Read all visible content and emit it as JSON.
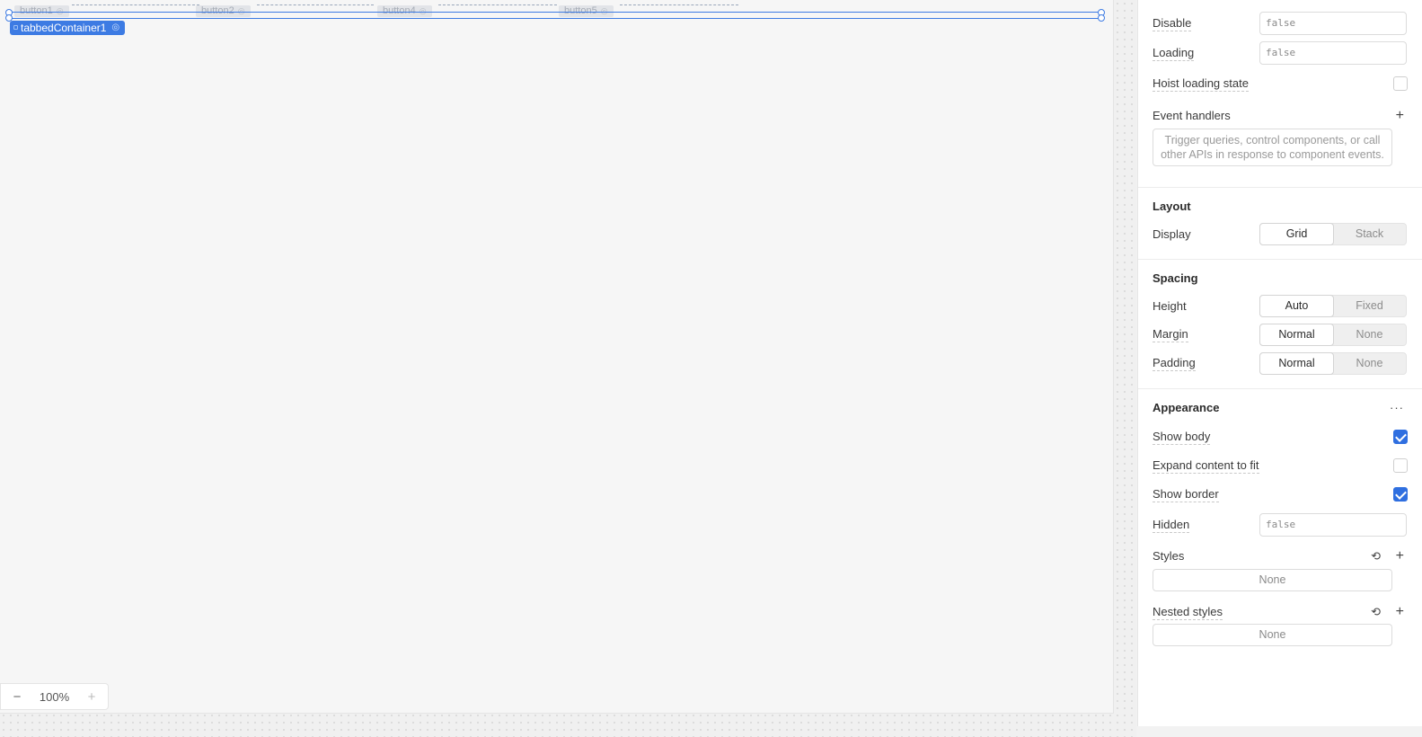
{
  "canvas": {
    "tabs": [
      {
        "label": "button1"
      },
      {
        "label": "button2"
      },
      {
        "label": "button4"
      },
      {
        "label": "button5"
      }
    ],
    "selected_component": "tabbedContainer1",
    "zoom": {
      "value": "100%",
      "minus": "−",
      "plus": "+"
    }
  },
  "inspector": {
    "interaction": {
      "disable": {
        "label": "Disable",
        "value": "false"
      },
      "loading": {
        "label": "Loading",
        "value": "false"
      },
      "hoist_loading": {
        "label": "Hoist loading state",
        "checked": false
      },
      "event_handlers": {
        "label": "Event handlers",
        "placeholder": "Trigger queries, control components, or call other APIs in response to component events."
      }
    },
    "layout": {
      "title": "Layout",
      "display": {
        "label": "Display",
        "options": [
          "Grid",
          "Stack"
        ],
        "selected": "Grid"
      }
    },
    "spacing": {
      "title": "Spacing",
      "height": {
        "label": "Height",
        "options": [
          "Auto",
          "Fixed"
        ],
        "selected": "Auto"
      },
      "margin": {
        "label": "Margin",
        "options": [
          "Normal",
          "None"
        ],
        "selected": "Normal"
      },
      "padding": {
        "label": "Padding",
        "options": [
          "Normal",
          "None"
        ],
        "selected": "Normal"
      }
    },
    "appearance": {
      "title": "Appearance",
      "show_body": {
        "label": "Show body",
        "checked": true
      },
      "expand_content": {
        "label": "Expand content to fit",
        "checked": false
      },
      "show_border": {
        "label": "Show border",
        "checked": true
      },
      "hidden": {
        "label": "Hidden",
        "value": "false"
      },
      "styles": {
        "label": "Styles",
        "value": "None"
      },
      "nested_styles": {
        "label": "Nested styles",
        "value": "None"
      }
    }
  },
  "colors": {
    "accent": "#2f6fe0",
    "selection": "#3d7be3"
  }
}
